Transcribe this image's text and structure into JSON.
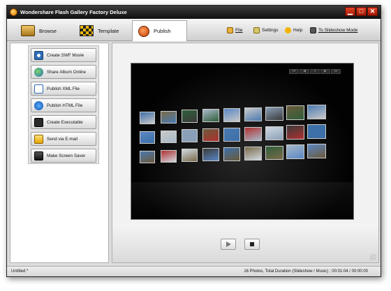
{
  "window": {
    "title": "Wondershare Flash Gallery Factory Deluxe",
    "controls": {
      "minimize": "▁",
      "maximize": "□",
      "close": "✕"
    }
  },
  "tabs": [
    {
      "label": "Browse",
      "icon": "folder-icon",
      "active": false
    },
    {
      "label": "Template",
      "icon": "template-icon",
      "active": false
    },
    {
      "label": "Publish",
      "icon": "publish-icon",
      "active": true
    }
  ],
  "menu": {
    "file": {
      "label": "File",
      "icon": "file-icon"
    },
    "settings": {
      "label": "Settings",
      "icon": "settings-icon"
    },
    "help": {
      "label": "Help",
      "icon": "help-icon"
    },
    "slideshow": {
      "label": "To Slideshow Mode",
      "icon": "slideshow-icon"
    }
  },
  "actions": [
    {
      "label": "Create SWF Movie",
      "icon": "swf-icon"
    },
    {
      "label": "Share Album Online",
      "icon": "share-globe-icon"
    },
    {
      "label": "Publish XML File",
      "icon": "xml-file-icon"
    },
    {
      "label": "Publish HTML File",
      "icon": "html-ie-icon"
    },
    {
      "label": "Create Executable",
      "icon": "exe-icon"
    },
    {
      "label": "Send via E-mail",
      "icon": "email-icon"
    },
    {
      "label": "Make Screen Saver",
      "icon": "screen-saver-icon"
    }
  ],
  "preview": {
    "mini_controls": [
      "⏮",
      "◀",
      "⏸",
      "▶",
      "⏭"
    ],
    "play_label": "▶",
    "stop_label": "■"
  },
  "status": {
    "left": "Untitled *",
    "right": "16 Photos, Total Duration (Slideshow / Music) : 00:01:04 / 00:00:00"
  },
  "colors": {
    "accent": "#e07b00",
    "titlebar": "#1a1a1a",
    "close": "#c42a10"
  }
}
